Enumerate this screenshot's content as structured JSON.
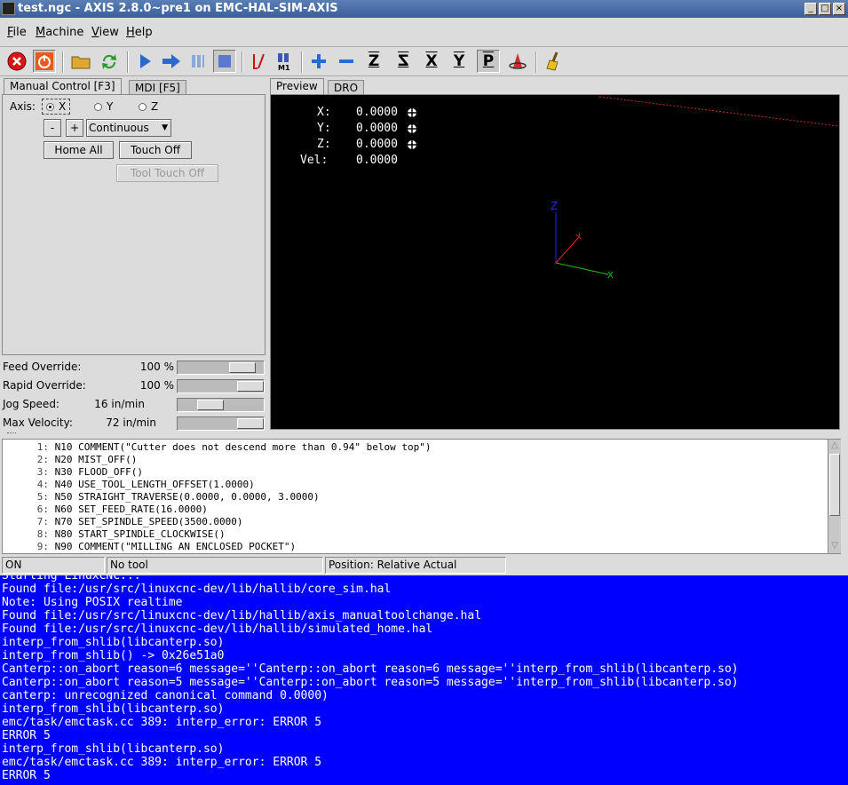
{
  "window": {
    "title": "test.ngc - AXIS 2.8.0~pre1 on EMC-HAL-SIM-AXIS",
    "controls": [
      "_",
      "□",
      "×"
    ]
  },
  "menu": [
    {
      "label": "File",
      "underline": "F",
      "rest": "ile"
    },
    {
      "label": "Machine",
      "underline": "M",
      "rest": "achine"
    },
    {
      "label": "View",
      "underline": "V",
      "rest": "iew"
    },
    {
      "label": "Help",
      "underline": "H",
      "rest": "elp"
    }
  ],
  "toolbar": {
    "estop_icon": "estop-icon",
    "power_icon": "power-icon",
    "buttons": {
      "z_label": "Z",
      "z_rot_label": "Z",
      "x_label": "X",
      "y_label": "Y",
      "p_label": "P",
      "m1_label": "M1"
    }
  },
  "left_tabs": [
    "Manual Control [F3]",
    "MDI [F5]"
  ],
  "manual": {
    "axis_label": "Axis:",
    "axes": [
      "X",
      "Y",
      "Z"
    ],
    "selected_axis": "X",
    "minus_label": "-",
    "plus_label": "+",
    "jog_mode": "Continuous",
    "home_all": "Home All",
    "touch_off": "Touch Off",
    "tool_touch_off": "Tool Touch Off"
  },
  "sliders": [
    {
      "label": "Feed Override:",
      "value": "100 %"
    },
    {
      "label": "Rapid Override:",
      "value": "100 %"
    },
    {
      "label": "Jog Speed:",
      "value": "16 in/min"
    },
    {
      "label": "Max Velocity:",
      "value": "72 in/min"
    }
  ],
  "right_tabs": [
    "Preview",
    "DRO"
  ],
  "dro": [
    {
      "axis": "X:",
      "value": "0.0000"
    },
    {
      "axis": "Y:",
      "value": "0.0000"
    },
    {
      "axis": "Z:",
      "value": "0.0000"
    },
    {
      "axis": "Vel:",
      "value": "0.0000"
    }
  ],
  "preview_axes": {
    "z": "Z",
    "y": "Y",
    "x": "X"
  },
  "gcode": [
    {
      "n": "1:",
      "text": "N10 COMMENT(\"Cutter does not descend more than 0.94\" below top\")"
    },
    {
      "n": "2:",
      "text": "N20 MIST_OFF()"
    },
    {
      "n": "3:",
      "text": "N30 FLOOD_OFF()"
    },
    {
      "n": "4:",
      "text": "N40 USE_TOOL_LENGTH_OFFSET(1.0000)"
    },
    {
      "n": "5:",
      "text": "N50 STRAIGHT_TRAVERSE(0.0000, 0.0000, 3.0000)"
    },
    {
      "n": "6:",
      "text": "N60 SET_FEED_RATE(16.0000)"
    },
    {
      "n": "7:",
      "text": "N70 SET_SPINDLE_SPEED(3500.0000)"
    },
    {
      "n": "8:",
      "text": "N80 START_SPINDLE_CLOCKWISE()"
    },
    {
      "n": "9:",
      "text": "N90 COMMENT(\"MILLING AN ENCLOSED POCKET\")"
    }
  ],
  "status": {
    "state": "ON",
    "tool": "No tool",
    "position": "Position: Relative Actual"
  },
  "terminal": [
    "Starting LinuxCNC...",
    "Found file:/usr/src/linuxcnc-dev/lib/hallib/core_sim.hal",
    "Note: Using POSIX realtime",
    "Found file:/usr/src/linuxcnc-dev/lib/hallib/axis_manualtoolchange.hal",
    "Found file:/usr/src/linuxcnc-dev/lib/hallib/simulated_home.hal",
    "interp_from_shlib(libcanterp.so)",
    "interp_from_shlib() -> 0x26e51a0",
    "Canterp::on_abort reason=6 message=''Canterp::on_abort reason=6 message=''interp_from_shlib(libcanterp.so)",
    "Canterp::on_abort reason=5 message=''Canterp::on_abort reason=5 message=''interp_from_shlib(libcanterp.so)",
    "canterp: unrecognized canonical command 0.0000)",
    "interp_from_shlib(libcanterp.so)",
    "emc/task/emctask.cc 389: interp_error: ERROR 5",
    "ERROR 5",
    "interp_from_shlib(libcanterp.so)",
    "emc/task/emctask.cc 389: interp_error: ERROR 5",
    "ERROR 5"
  ]
}
